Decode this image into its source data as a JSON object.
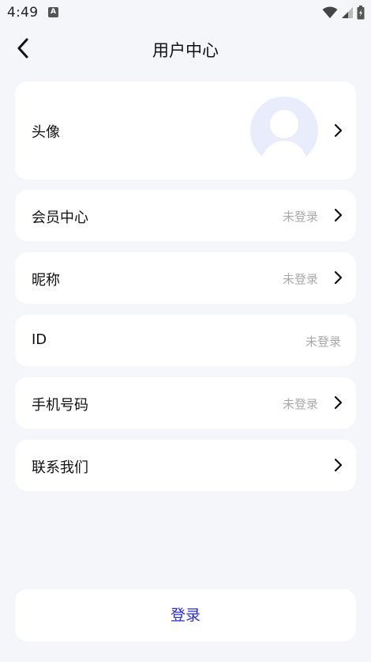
{
  "status_bar": {
    "time": "4:49",
    "notification_icon": "A"
  },
  "header": {
    "title": "用户中心"
  },
  "rows": [
    {
      "label": "头像",
      "value": ""
    },
    {
      "label": "会员中心",
      "value": "未登录"
    },
    {
      "label": "昵称",
      "value": "未登录"
    },
    {
      "label": "ID",
      "value": "未登录"
    },
    {
      "label": "手机号码",
      "value": "未登录"
    },
    {
      "label": "联系我们",
      "value": ""
    }
  ],
  "login": {
    "label": "登录"
  },
  "colors": {
    "background": "#f5f6fa",
    "card": "#ffffff",
    "muted_text": "#a9a9a9",
    "accent": "#2a2ad6",
    "avatar_bg": "#e9ecfb"
  }
}
